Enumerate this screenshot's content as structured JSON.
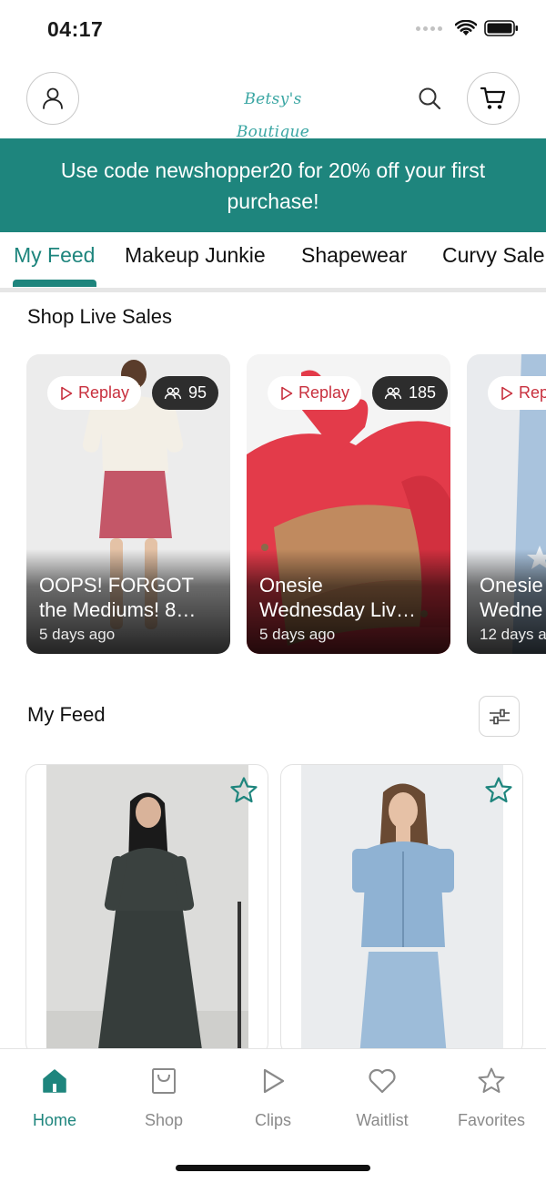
{
  "status": {
    "time": "04:17"
  },
  "header": {
    "logo_text": "Betsy's Boutique"
  },
  "promo": {
    "text": "Use code newshopper20 for 20% off your first purchase!"
  },
  "tabs": [
    {
      "label": "My Feed",
      "active": true
    },
    {
      "label": "Makeup Junkie"
    },
    {
      "label": "Shapewear"
    },
    {
      "label": "Curvy Sale"
    }
  ],
  "live_section": {
    "title": "Shop Live Sales",
    "replay_label": "Replay",
    "cards": [
      {
        "title_line1": "OOPS! FORGOT",
        "title_line2": "the Mediums! 8…",
        "time": "5 days ago",
        "viewers": "95"
      },
      {
        "title_line1": "Onesie",
        "title_line2": "Wednesday Liv…",
        "time": "5 days ago",
        "viewers": "185"
      },
      {
        "title_line1": "Onesie",
        "title_line2": "Wedne",
        "time": "12 days a"
      }
    ]
  },
  "feed": {
    "title": "My Feed"
  },
  "bottom_nav": [
    {
      "label": "Home",
      "icon": "home-icon",
      "active": true
    },
    {
      "label": "Shop",
      "icon": "shopping-bag-icon"
    },
    {
      "label": "Clips",
      "icon": "play-icon"
    },
    {
      "label": "Waitlist",
      "icon": "heart-icon"
    },
    {
      "label": "Favorites",
      "icon": "star-icon"
    }
  ],
  "colors": {
    "accent": "#1e857d",
    "replay_red": "#c8303e",
    "inactive_nav": "#8a8a8a"
  }
}
